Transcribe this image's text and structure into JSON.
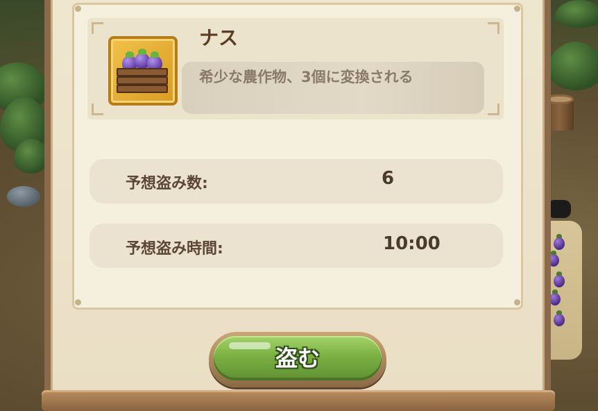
{
  "item": {
    "name": "ナス",
    "description": "希少な農作物、3個に変換される",
    "icon": "eggplant-crate-icon"
  },
  "stats": [
    {
      "label": "予想盗み数:",
      "value": "6"
    },
    {
      "label": "予想盗み時間:",
      "value": "10:00"
    }
  ],
  "action": {
    "steal_label": "盗む"
  },
  "colors": {
    "button_green": "#7bb043",
    "icon_gold": "#e0a82e",
    "panel_bg": "#efe6cf",
    "text_brown": "#5a3d23"
  }
}
